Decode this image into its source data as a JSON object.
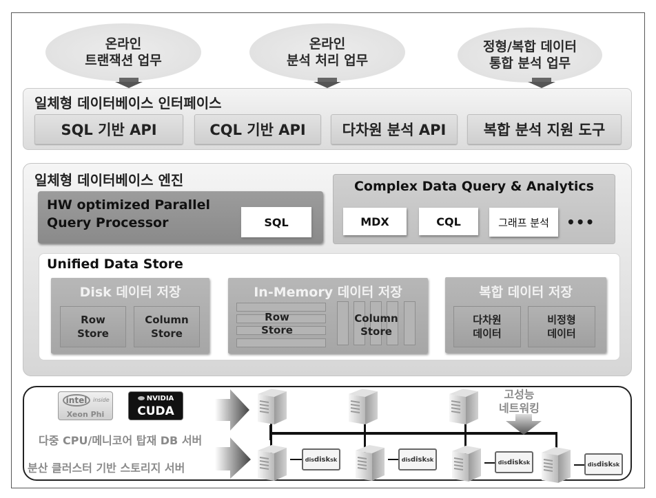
{
  "workloads": [
    {
      "lines": [
        "온라인",
        "트랜잭션 업무"
      ]
    },
    {
      "lines": [
        "온라인",
        "분석 처리 업무"
      ]
    },
    {
      "lines": [
        "정형/복합 데이터",
        "통합 분석 업무"
      ]
    }
  ],
  "interface": {
    "title": "일체형 데이터베이스 인터페이스",
    "apis": [
      "SQL 기반 API",
      "CQL 기반 API",
      "다차원 분석 API",
      "복합 분석 지원 도구"
    ]
  },
  "engine": {
    "title": "일체형 데이터베이스 엔진",
    "query_processor": {
      "title_lines": [
        "HW optimized Parallel",
        "Query Processor"
      ],
      "chip": "SQL"
    },
    "complex_query": {
      "title": "Complex Data Query & Analytics",
      "chips": [
        "MDX",
        "CQL",
        "그래프 분석"
      ],
      "more": "•••"
    },
    "unified_store": {
      "title": "Unified Data Store",
      "disk": {
        "title": "Disk 데이터 저장",
        "cells": [
          {
            "lines": [
              "Row",
              "Store"
            ]
          },
          {
            "lines": [
              "Column",
              "Store"
            ]
          }
        ]
      },
      "in_memory": {
        "title": "In-Memory 데이터 저장",
        "row_label": [
          "Row",
          "Store"
        ],
        "column_label": [
          "Column",
          "Store"
        ]
      },
      "complex": {
        "title": "복합 데이터 저장",
        "cells": [
          {
            "lines": [
              "다차원",
              "데이터"
            ]
          },
          {
            "lines": [
              "비정형",
              "데이터"
            ]
          }
        ]
      }
    }
  },
  "hardware": {
    "logos": {
      "intel": {
        "brand": "intel",
        "tag": "inside",
        "product": "Xeon Phi"
      },
      "nvidia": {
        "brand": "NVIDIA",
        "product": "CUDA"
      }
    },
    "db_server_label": "다중 CPU/메니코어 탑재 DB 서버",
    "storage_server_label": "분산 클러스터 기반 스토리지 서버",
    "network_label": [
      "고성능",
      "네트워킹"
    ],
    "disk_label": {
      "left": "dis",
      "center": "disk",
      "right": "sk"
    }
  }
}
